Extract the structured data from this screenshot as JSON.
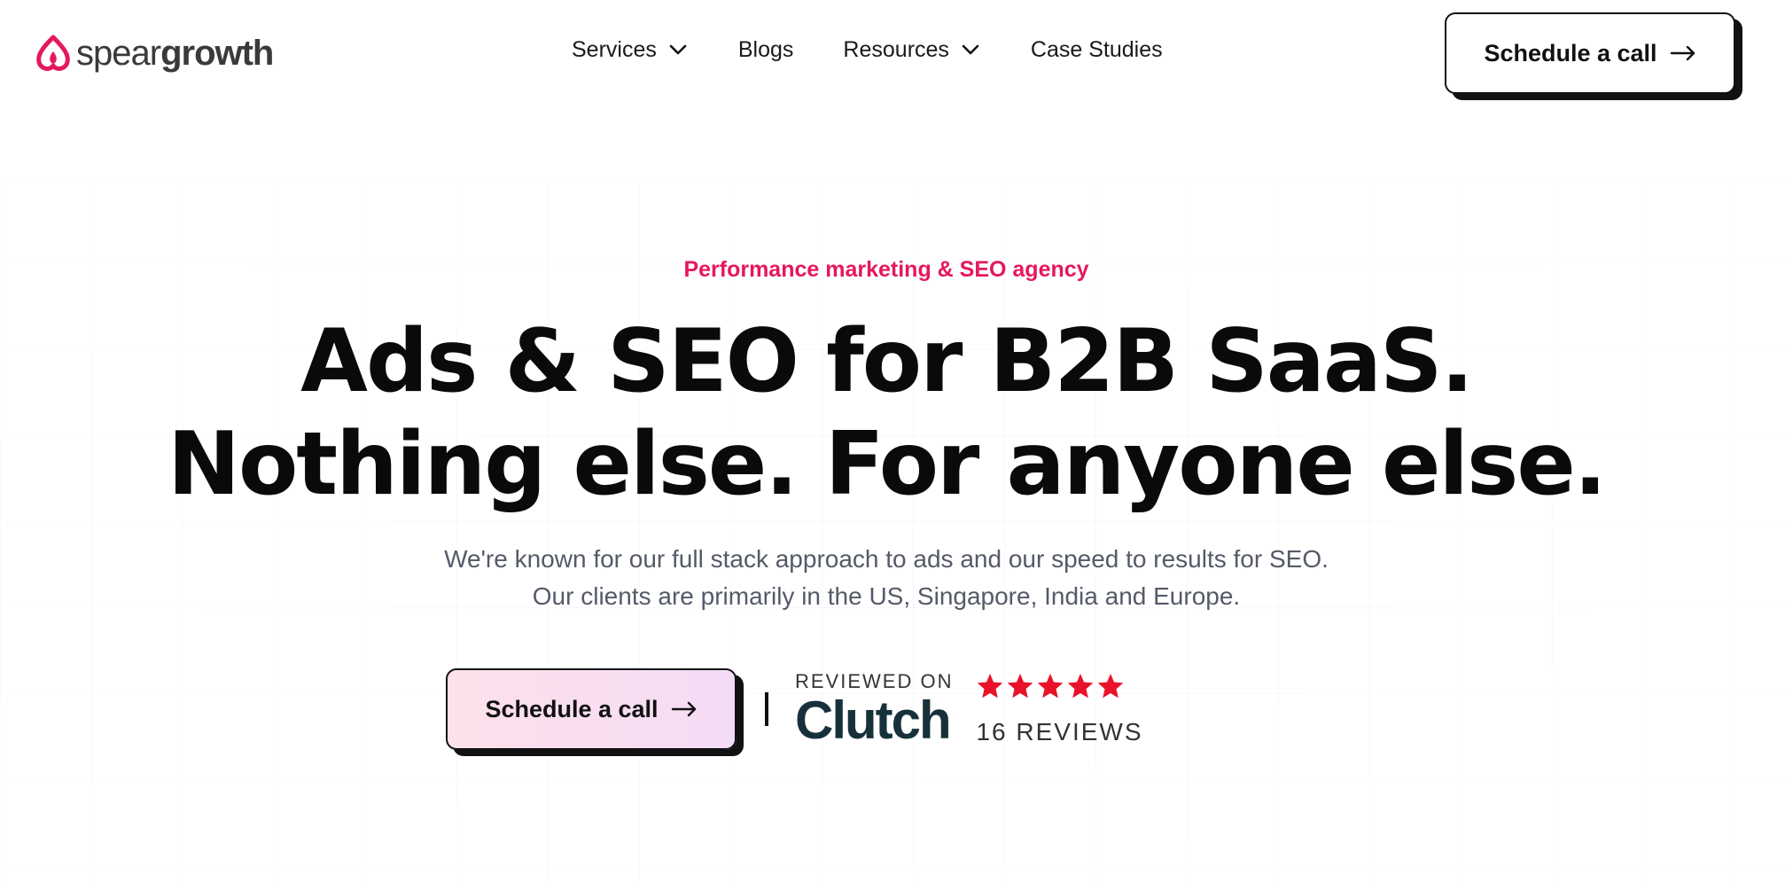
{
  "brand": {
    "logo_text_light": "spear",
    "logo_text_bold": "growth",
    "accent_color": "#e5175f"
  },
  "nav": {
    "items": [
      {
        "label": "Services",
        "has_dropdown": true
      },
      {
        "label": "Blogs",
        "has_dropdown": false
      },
      {
        "label": "Resources",
        "has_dropdown": true
      },
      {
        "label": "Case Studies",
        "has_dropdown": false
      }
    ],
    "cta_label": "Schedule a call",
    "cta_icon": "arrow-right-icon"
  },
  "hero": {
    "eyebrow": "Performance marketing & SEO agency",
    "headline_line1": "Ads & SEO for B2B SaaS.",
    "headline_line2": "Nothing else. For anyone else.",
    "sub_line1": "We're known for our full stack approach to ads and our speed to results for SEO.",
    "sub_line2": "Our clients are primarily in the US, Singapore, India and Europe.",
    "cta_label": "Schedule a call"
  },
  "review": {
    "reviewed_on": "REVIEWED ON",
    "platform": "Clutch",
    "stars": 5,
    "star_color": "#e8132a",
    "count_text": "16 REVIEWS"
  }
}
